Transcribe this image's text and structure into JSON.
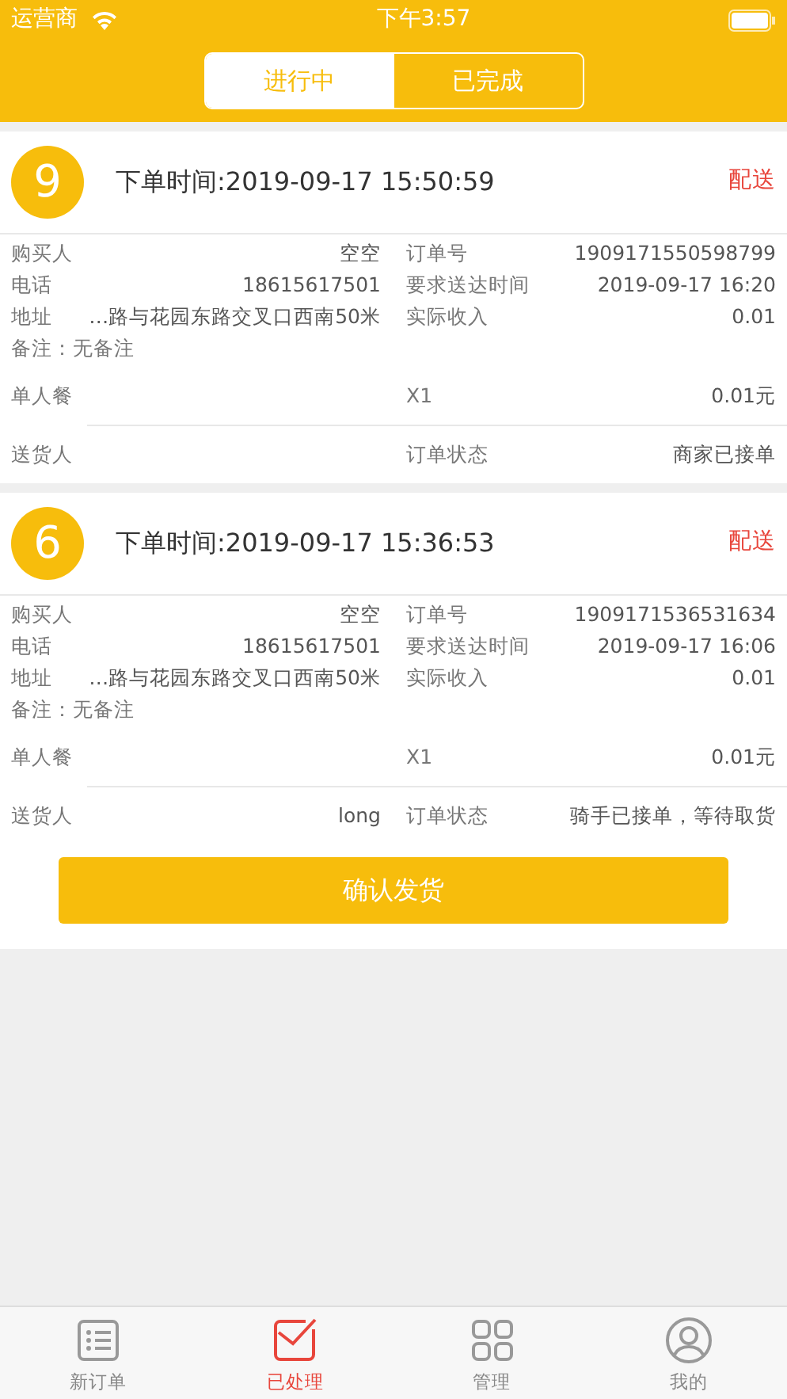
{
  "status_bar": {
    "carrier": "运营商",
    "time": "下午3:57"
  },
  "segments": [
    {
      "label": "进行中",
      "selected": true
    },
    {
      "label": "已完成",
      "selected": false
    }
  ],
  "orders": [
    {
      "number": "9",
      "order_time": "下单时间:2019-09-17 15:50:59",
      "action": "配送",
      "buyer_label": "购买人",
      "buyer": "空空",
      "order_no_label": "订单号",
      "order_no": "1909171550598799",
      "phone_label": "电话",
      "phone": "18615617501",
      "deliver_by_label": "要求送达时间",
      "deliver_by": "2019-09-17 16:20",
      "address_label": "地址",
      "address": "…路与花园东路交叉口西南50米",
      "income_label": "实际收入",
      "income": "0.01",
      "remark": "备注：无备注",
      "item": "单人餐",
      "qty": "X1",
      "price": "0.01元",
      "courier_label": "送货人",
      "order_status_label": "订单状态",
      "order_status": "商家已接单"
    },
    {
      "number": "6",
      "order_time": "下单时间:2019-09-17 15:36:53",
      "action": "配送",
      "buyer_label": "购买人",
      "buyer": "空空",
      "order_no_label": "订单号",
      "order_no": "1909171536531634",
      "phone_label": "电话",
      "phone": "18615617501",
      "deliver_by_label": "要求送达时间",
      "deliver_by": "2019-09-17 16:06",
      "address_label": "地址",
      "address": "…路与花园东路交叉口西南50米",
      "income_label": "实际收入",
      "income": "0.01",
      "remark": "备注：无备注",
      "item": "单人餐",
      "qty": "X1",
      "price": "0.01元",
      "courier_label": "送货人",
      "courier": "long",
      "order_status_label": "订单状态",
      "order_status": "骑手已接单，等待取货",
      "button": "确认发货"
    }
  ],
  "tab_bar": [
    {
      "kind": "list",
      "label": "新订单",
      "selected": false
    },
    {
      "kind": "mail",
      "label": "已处理",
      "selected": true
    },
    {
      "kind": "grid",
      "label": "管理",
      "selected": false
    },
    {
      "kind": "user",
      "label": "我的",
      "selected": false
    }
  ]
}
